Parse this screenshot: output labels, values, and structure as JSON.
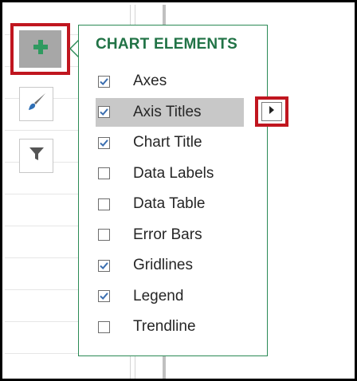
{
  "panel": {
    "title": "CHART ELEMENTS",
    "items": [
      {
        "label": "Axes",
        "checked": true
      },
      {
        "label": "Axis Titles",
        "checked": true,
        "highlighted": true,
        "has_submenu": true
      },
      {
        "label": "Chart Title",
        "checked": true
      },
      {
        "label": "Data Labels",
        "checked": false
      },
      {
        "label": "Data Table",
        "checked": false
      },
      {
        "label": "Error Bars",
        "checked": false
      },
      {
        "label": "Gridlines",
        "checked": true
      },
      {
        "label": "Legend",
        "checked": true
      },
      {
        "label": "Trendline",
        "checked": false
      }
    ]
  },
  "side_buttons": {
    "chart_elements_icon": "plus-icon",
    "chart_styles_icon": "paintbrush-icon",
    "chart_filters_icon": "filter-icon"
  },
  "colors": {
    "accent_green": "#217346",
    "highlight_red": "#c0161f",
    "check_blue": "#3c6fb0",
    "hover_gray": "#c8c8c8"
  }
}
